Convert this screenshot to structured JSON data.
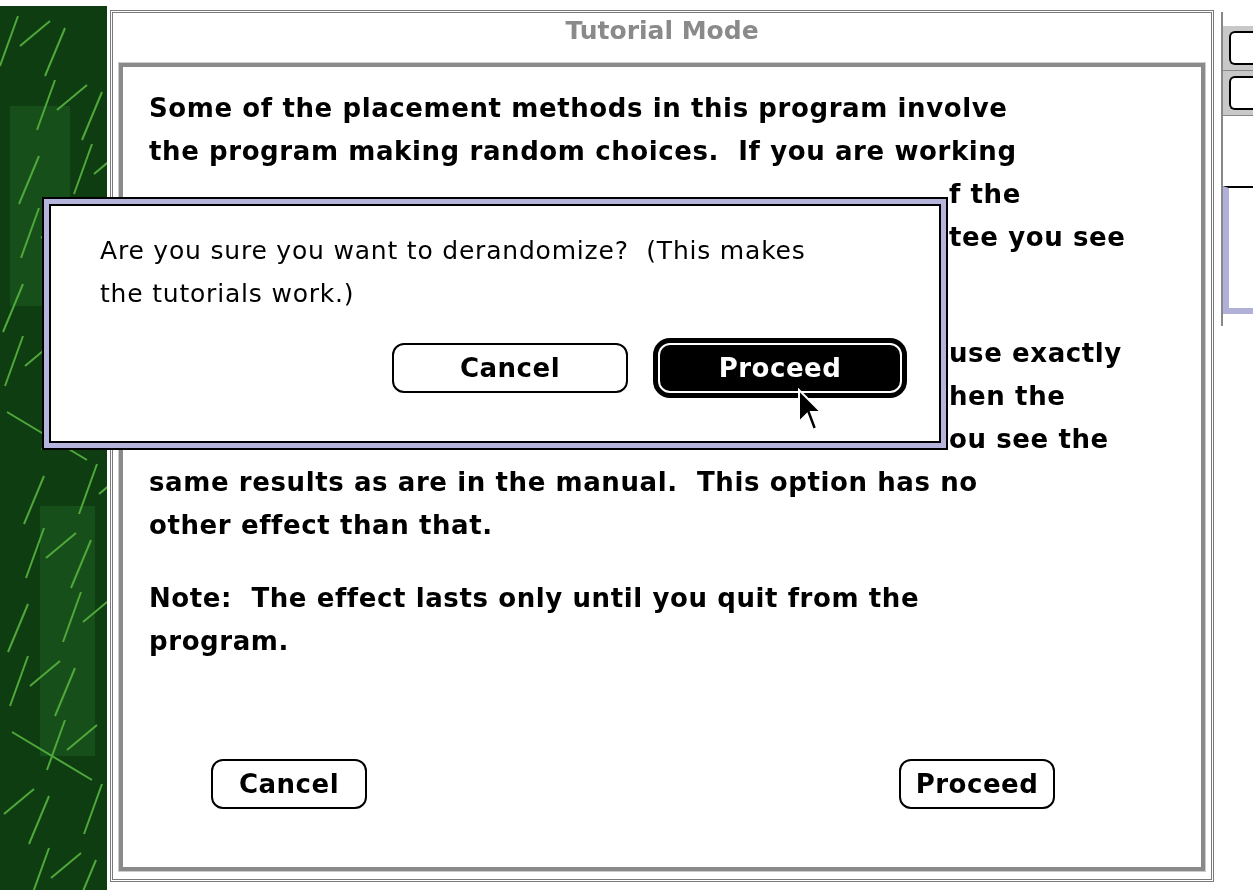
{
  "window": {
    "title": "Tutorial Mode"
  },
  "paragraphs": [
    {
      "lines": [
        {
          "kind": "full",
          "text": "Some of the placement methods in this program involve"
        },
        {
          "kind": "full",
          "text": "the program making random choices.  If you are working"
        },
        {
          "kind": "fragment",
          "text": "f the"
        },
        {
          "kind": "fragment",
          "text": "tee you see"
        }
      ]
    },
    {
      "lines": [
        {
          "kind": "fragment",
          "text": "use exactly"
        },
        {
          "kind": "fragment",
          "text": "hen the"
        },
        {
          "kind": "fragment",
          "text": "ou see the"
        },
        {
          "kind": "full",
          "text": "same results as are in the manual.  This option has no"
        },
        {
          "kind": "full",
          "text": "other effect than that."
        }
      ]
    },
    {
      "lines": [
        {
          "kind": "full",
          "text": "Note:  The effect lasts only until you quit from the"
        },
        {
          "kind": "full",
          "text": "program."
        }
      ]
    }
  ],
  "buttons": [
    {
      "label": "Cancel",
      "default": false
    },
    {
      "label": "Proceed",
      "default": false
    }
  ],
  "dialog": {
    "message": "Are you sure you want to derandomize?  (This makes the tutorials work.)",
    "buttons": [
      {
        "label": "Cancel",
        "default": false
      },
      {
        "label": "Proceed",
        "default": true
      }
    ]
  }
}
